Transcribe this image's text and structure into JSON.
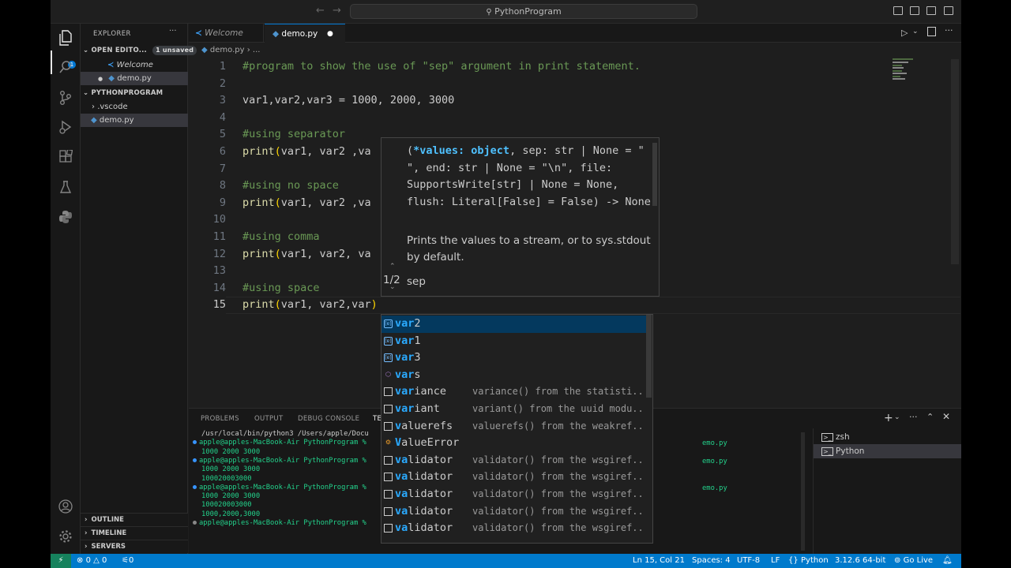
{
  "window": {
    "title": "PythonProgram"
  },
  "sidebar": {
    "title": "EXPLORER",
    "open_editors": {
      "label": "OPEN EDITO...",
      "badge": "1 unsaved",
      "items": [
        "Welcome",
        "demo.py"
      ]
    },
    "project": {
      "label": "PYTHONPROGRAM",
      "items": [
        ".vscode",
        "demo.py"
      ]
    },
    "sections": [
      "OUTLINE",
      "TIMELINE",
      "SERVERS"
    ]
  },
  "tabs": [
    {
      "label": "Welcome"
    },
    {
      "label": "demo.py"
    }
  ],
  "breadcrumb": {
    "file": "demo.py",
    "rest": "..."
  },
  "editor": {
    "lines": [
      {
        "n": "1",
        "text": "#program to show the use of \"sep\" argument in print statement."
      },
      {
        "n": "2",
        "text": ""
      },
      {
        "n": "3",
        "text": "var1,var2,var3 = 1000, 2000, 3000"
      },
      {
        "n": "4",
        "text": ""
      },
      {
        "n": "5",
        "text": "#using separator"
      },
      {
        "n": "6",
        "text": "print(var1, var2 ,va"
      },
      {
        "n": "7",
        "text": ""
      },
      {
        "n": "8",
        "text": "#using no space"
      },
      {
        "n": "9",
        "text": "print(var1, var2 ,va"
      },
      {
        "n": "10",
        "text": ""
      },
      {
        "n": "11",
        "text": "#using comma"
      },
      {
        "n": "12",
        "text": "print(var1, var2, va"
      },
      {
        "n": "13",
        "text": ""
      },
      {
        "n": "14",
        "text": "#using space"
      },
      {
        "n": "15",
        "text": "print(var1, var2,var)"
      }
    ]
  },
  "hover": {
    "signature_open": "(",
    "signature_param": "*values: object",
    "signature_rest": ", sep: str | None = \" \", end: str | None = \"\\n\", file: SupportsWrite[str] | None = None, flush: Literal[False] = False) -> None",
    "doc": "Prints the values to a stream, or to sys.stdout by default.",
    "overload": "1/2",
    "param": "sep"
  },
  "suggest": [
    {
      "match": "var",
      "rest": "2",
      "detail": "",
      "icon": "variable-icon"
    },
    {
      "match": "var",
      "rest": "1",
      "detail": "",
      "icon": "variable-icon"
    },
    {
      "match": "var",
      "rest": "3",
      "detail": "",
      "icon": "variable-icon"
    },
    {
      "match": "var",
      "rest": "s",
      "detail": "",
      "icon": "function-cube-icon"
    },
    {
      "match": "var",
      "rest": "iance",
      "detail": "variance() from the statisti...",
      "icon": "module-icon"
    },
    {
      "match": "var",
      "rest": "iant",
      "detail": "variant() from the uuid modu...",
      "icon": "module-icon"
    },
    {
      "match": "v",
      "rest": "aluerefs",
      "detail": "valuerefs() from the weakref...",
      "icon": "module-icon"
    },
    {
      "match": "V",
      "rest": "alueError",
      "detail": "",
      "icon": "class-icon"
    },
    {
      "match": "va",
      "rest": "lidator",
      "detail": "validator() from the wsgiref...",
      "icon": "module-icon"
    },
    {
      "match": "va",
      "rest": "lidator",
      "detail": "validator() from the wsgiref...",
      "icon": "module-icon"
    },
    {
      "match": "va",
      "rest": "lidator",
      "detail": "validator() from the wsgiref...",
      "icon": "module-icon"
    },
    {
      "match": "va",
      "rest": "lidator",
      "detail": "validator() from the wsgiref...",
      "icon": "module-icon"
    },
    {
      "match": "va",
      "rest": "lidator",
      "detail": "validator() from the wsgiref...",
      "icon": "module-icon"
    }
  ],
  "panel": {
    "tabs": [
      "PROBLEMS",
      "OUTPUT",
      "DEBUG CONSOLE",
      "TE"
    ],
    "terminal": [
      {
        "text": "/usr/local/bin/python3 /Users/apple/Docu",
        "kind": "plain"
      },
      {
        "text": "apple@apples-MacBook-Air PythonProgram %",
        "kind": "prompt",
        "dot": "blue"
      },
      {
        "text": "1000 2000 3000",
        "kind": "output"
      },
      {
        "text": "apple@apples-MacBook-Air PythonProgram %",
        "kind": "prompt",
        "dot": "blue"
      },
      {
        "text": "1000 2000 3000",
        "kind": "output"
      },
      {
        "text": "100020003000",
        "kind": "output"
      },
      {
        "text": "apple@apples-MacBook-Air PythonProgram %",
        "kind": "prompt",
        "dot": "blue"
      },
      {
        "text": "1000 2000 3000",
        "kind": "output"
      },
      {
        "text": "100020003000",
        "kind": "output"
      },
      {
        "text": "1000,2000,3000",
        "kind": "output"
      },
      {
        "text": "apple@apples-MacBook-Air PythonProgram %",
        "kind": "prompt",
        "dot": "gray"
      }
    ],
    "right_fragments": [
      "emo.py",
      "emo.py",
      "emo.py"
    ],
    "terminals": [
      "zsh",
      "Python"
    ]
  },
  "status": {
    "errors": "0",
    "warnings": "0",
    "ports": "0",
    "position": "Ln 15, Col 21",
    "spaces": "Spaces: 4",
    "encoding": "UTF-8",
    "eol": "LF",
    "language": "Python",
    "interpreter": "3.12.6 64-bit",
    "golive": "Go Live"
  },
  "colors": {
    "accent": "#007acc",
    "editor_bg": "#1e1e1e",
    "comment": "#6a9955",
    "function": "#dcdcaa",
    "terminal_text": "#23d18b"
  }
}
